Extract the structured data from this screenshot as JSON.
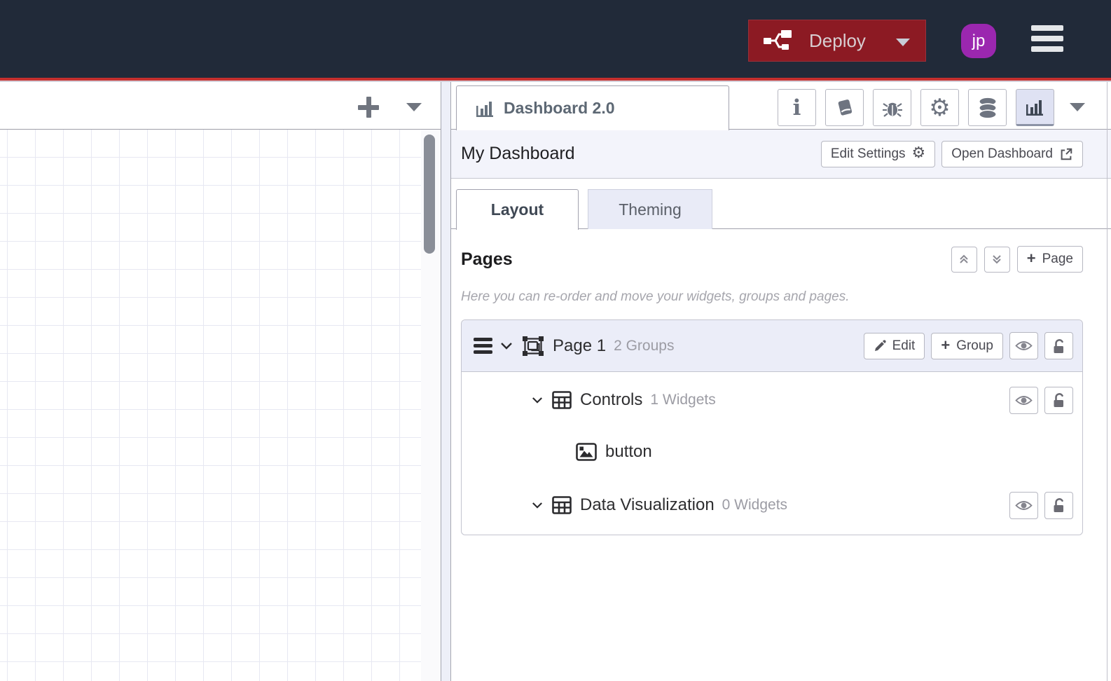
{
  "colors": {
    "header_bg": "#212a39",
    "accent_red": "#c5302e",
    "deploy_bg": "#8c1a23",
    "avatar_bg": "#9b27af",
    "inactive_tab_bg": "#e9ebf7",
    "selected_row_bg": "#ebedf8",
    "icon_gray": "#6e7480"
  },
  "header": {
    "deploy_label": "Deploy",
    "avatar_initials": "jp",
    "menu_icon": "hamburger-menu-icon",
    "deploy_icon": "deploy-nodes-icon"
  },
  "left_panel": {
    "add_flow_icon": "plus-icon",
    "flow_list_icon": "chevron-down-icon"
  },
  "sidebar": {
    "tab_title": "Dashboard 2.0",
    "tab_icon": "bar-chart-icon",
    "toolbar_icons": [
      "info-icon",
      "book-icon",
      "bug-icon",
      "gear-icon",
      "database-icon",
      "bar-chart-icon"
    ],
    "active_toolbar_icon": "bar-chart-icon",
    "dashboard_header": {
      "title": "My Dashboard",
      "edit_settings_label": "Edit Settings",
      "open_dashboard_label": "Open Dashboard"
    },
    "tabs": [
      {
        "label": "Layout",
        "active": true
      },
      {
        "label": "Theming",
        "active": false
      }
    ],
    "pages_section": {
      "title": "Pages",
      "move_up_icon": "double-chevron-up-icon",
      "move_down_icon": "double-chevron-down-icon",
      "add_page_label": "Page",
      "hint": "Here you can re-order and move your widgets, groups and pages.",
      "page": {
        "label": "Page 1",
        "meta": "2 Groups",
        "edit_label": "Edit",
        "add_group_label": "Group",
        "groups": [
          {
            "label": "Controls",
            "meta": "1 Widgets",
            "widgets": [
              {
                "label": "button"
              }
            ]
          },
          {
            "label": "Data Visualization",
            "meta": "0 Widgets",
            "widgets": []
          }
        ]
      }
    }
  }
}
